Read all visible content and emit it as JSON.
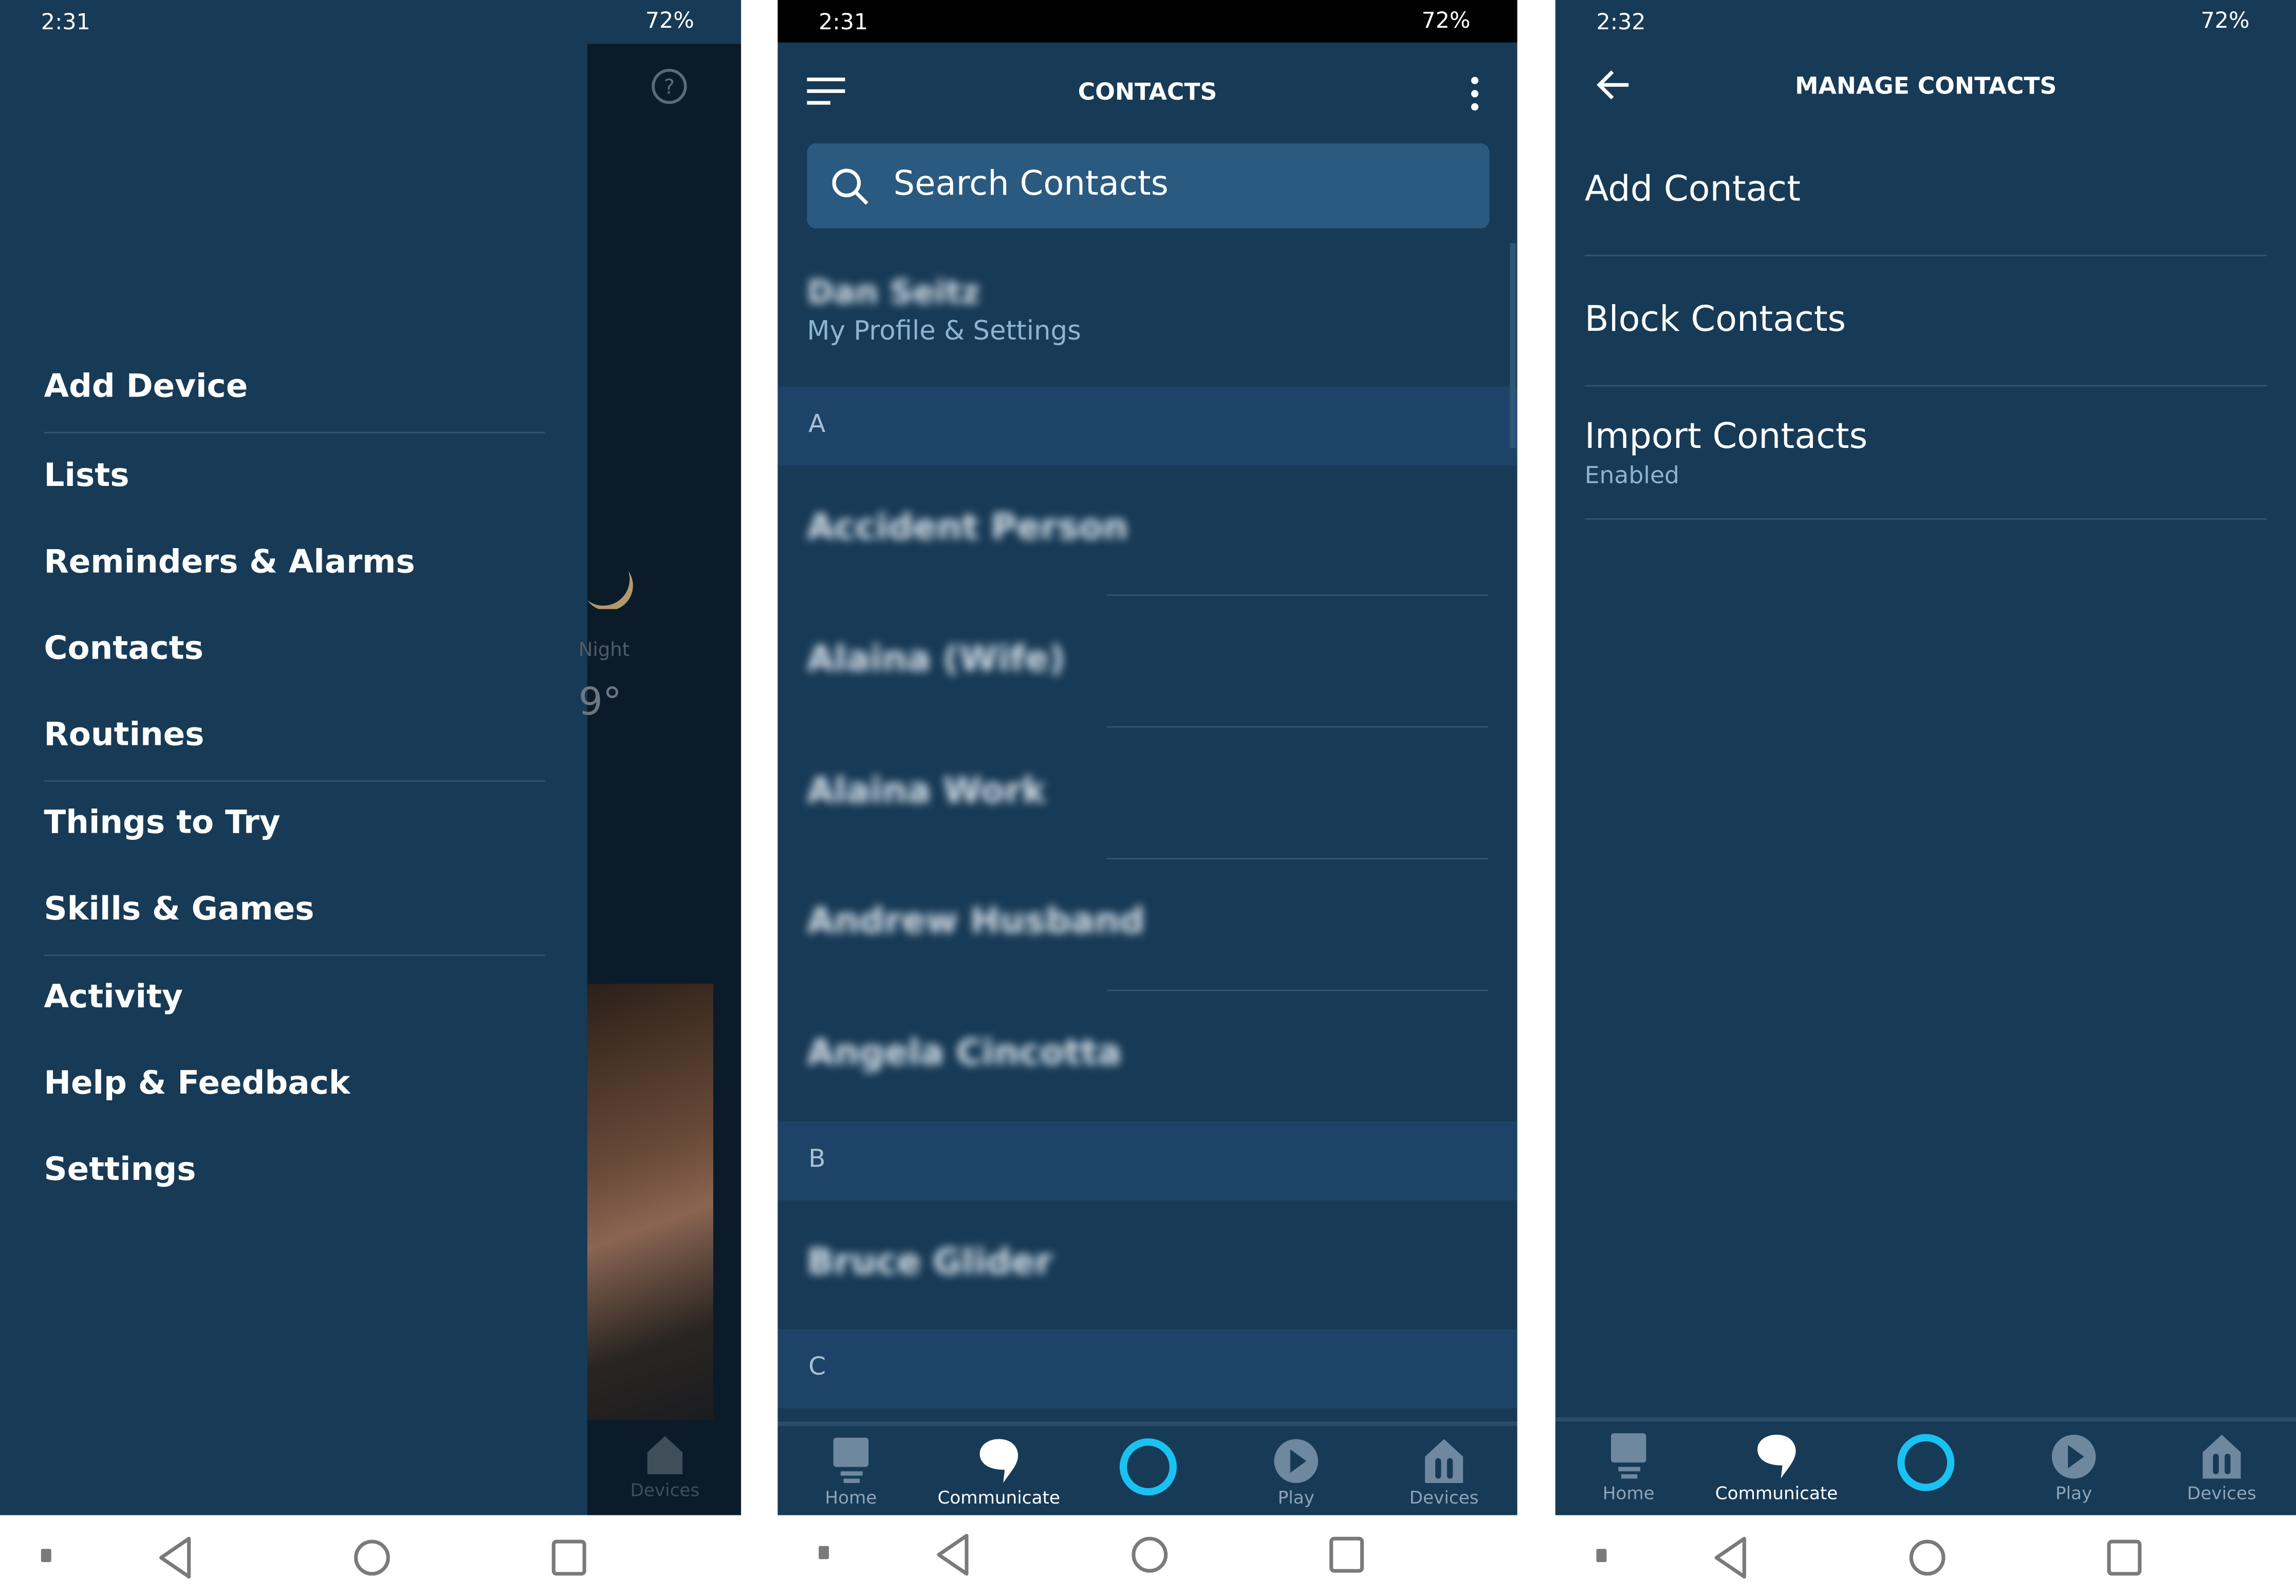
{
  "panels": [
    {
      "status": {
        "time": "2:31",
        "battery": "72%"
      },
      "menu": [
        "Add Device",
        "Lists",
        "Reminders & Alarms",
        "Contacts",
        "Routines",
        "Things to Try",
        "Skills & Games",
        "Activity",
        "Help & Feedback",
        "Settings"
      ],
      "background": {
        "weather_label": "Night",
        "temperature": "9°",
        "nav_devices": "Devices"
      }
    },
    {
      "status": {
        "time": "2:31",
        "battery": "72%"
      },
      "header": {
        "title": "CONTACTS"
      },
      "search": {
        "placeholder": "Search Contacts"
      },
      "profile": {
        "name": "Dan Seitz",
        "link": "My Profile & Settings"
      },
      "sections": [
        {
          "letter": "A",
          "contacts": [
            "Accident Person",
            "Alaina (Wife)",
            "Alaina Work",
            "Andrew Husband",
            "Angela Cincotta"
          ]
        },
        {
          "letter": "B",
          "contacts": [
            "Bruce Glider"
          ]
        },
        {
          "letter": "C",
          "contacts": []
        }
      ]
    },
    {
      "status": {
        "time": "2:32",
        "battery": "72%"
      },
      "header": {
        "title": "MANAGE CONTACTS"
      },
      "items": [
        {
          "label": "Add Contact"
        },
        {
          "label": "Block Contacts"
        },
        {
          "label": "Import Contacts",
          "sub": "Enabled"
        }
      ]
    }
  ],
  "bottom_nav": {
    "items": [
      "Home",
      "Communicate",
      "",
      "Play",
      "Devices"
    ],
    "active": "Communicate"
  },
  "colors": {
    "background": "#173a56",
    "section": "#1d4468",
    "alexa": "#1ac2f2",
    "accent_text": "#8cb4d4"
  }
}
